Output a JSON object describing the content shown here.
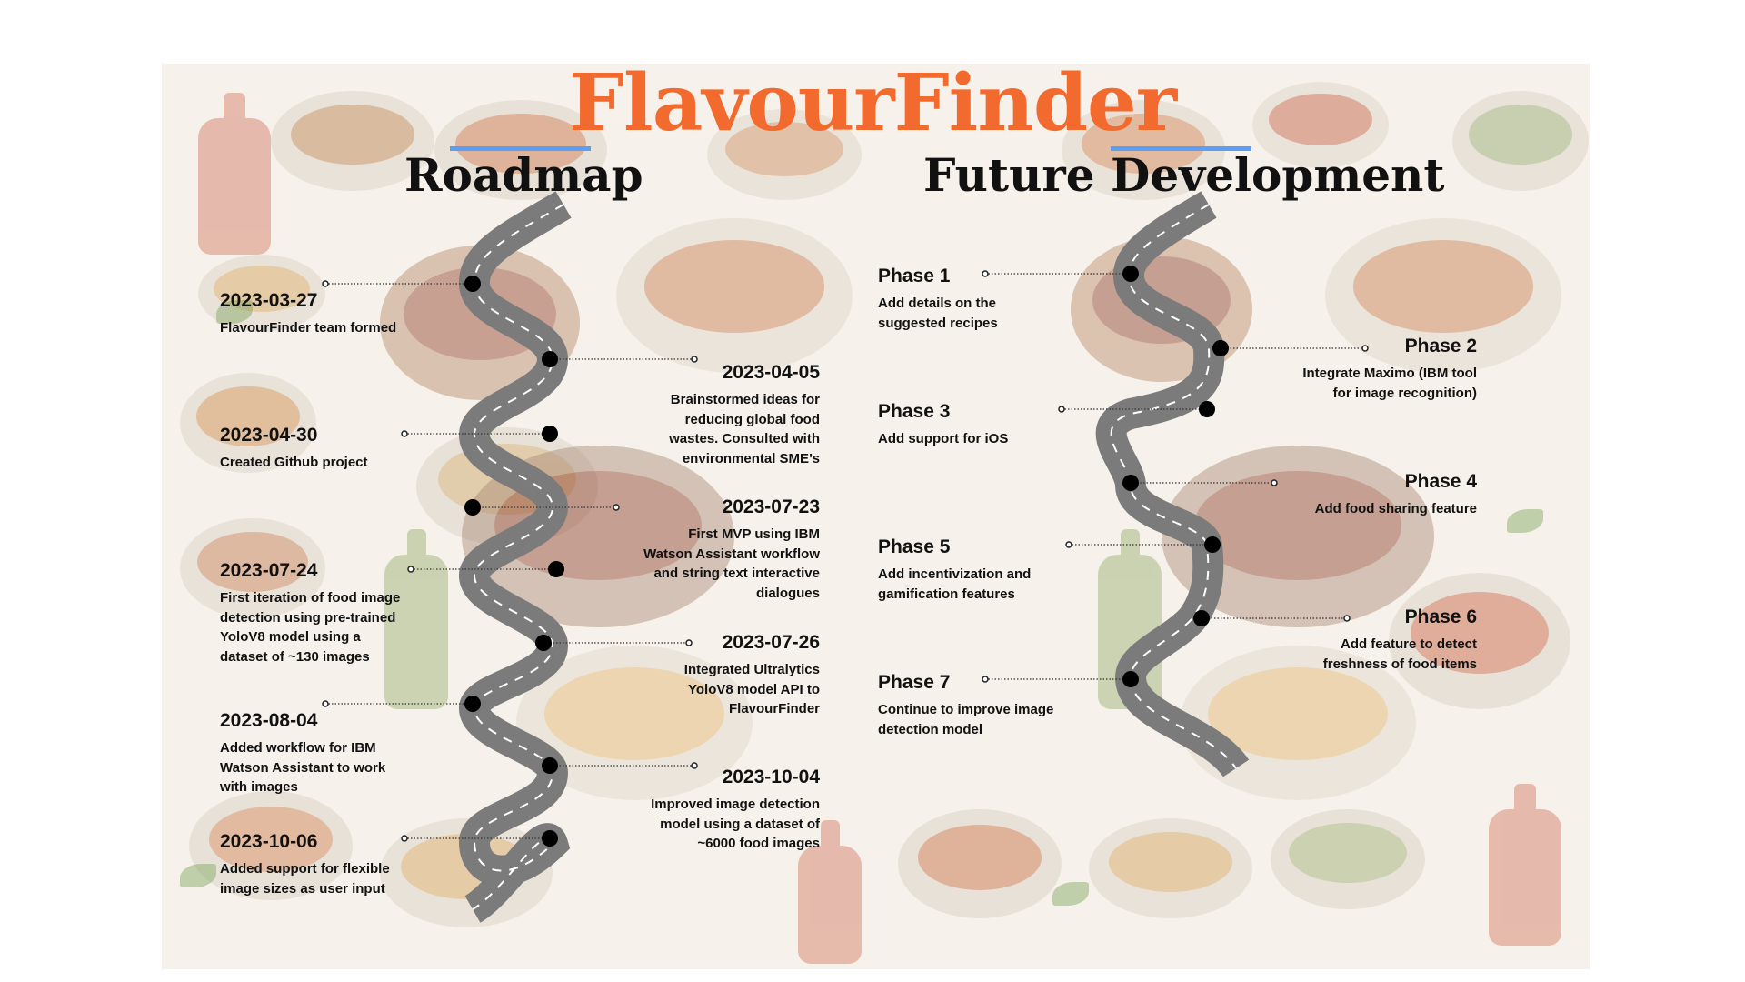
{
  "title": "FlavourFinder",
  "colors": {
    "title": "#f26a2e",
    "accent_underline": "#5b9ef2",
    "road": "#7b7b7b",
    "road_dash": "#ffffff",
    "milestone_dot": "#000000",
    "background": "#f6f1ea"
  },
  "roadmap": {
    "heading": "Roadmap",
    "milestones": [
      {
        "date": "2023-03-27",
        "text": "FlavourFinder team formed"
      },
      {
        "date": "2023-04-05",
        "text": "Brainstormed ideas for reducing global food wastes. Consulted with environmental SME’s"
      },
      {
        "date": "2023-04-30",
        "text": "Created Github project"
      },
      {
        "date": "2023-07-23",
        "text": "First MVP using IBM Watson Assistant workflow and string text interactive dialogues"
      },
      {
        "date": "2023-07-24",
        "text": "First iteration of food image detection using pre-trained YoloV8 model using a dataset of ~130 images"
      },
      {
        "date": "2023-07-26",
        "text": "Integrated Ultralytics YoloV8 model  API to FlavourFinder"
      },
      {
        "date": "2023-08-04",
        "text": "Added workflow for IBM Watson Assistant to work with images"
      },
      {
        "date": "2023-10-04",
        "text": "Improved image detection model using a dataset of ~6000 food images"
      },
      {
        "date": "2023-10-06",
        "text": "Added support for flexible image sizes as user input"
      }
    ]
  },
  "future": {
    "heading": "Future Development",
    "phases": [
      {
        "name": "Phase 1",
        "text": "Add details on the suggested recipes"
      },
      {
        "name": "Phase 2",
        "text": "Integrate Maximo (IBM tool for image recognition)"
      },
      {
        "name": "Phase 3",
        "text": "Add support for iOS"
      },
      {
        "name": "Phase 4",
        "text": "Add food sharing feature"
      },
      {
        "name": "Phase 5",
        "text": "Add incentivization and gamification features"
      },
      {
        "name": "Phase 6",
        "text": "Add feature to detect freshness of food items"
      },
      {
        "name": "Phase 7",
        "text": "Continue to improve image detection model"
      }
    ]
  }
}
